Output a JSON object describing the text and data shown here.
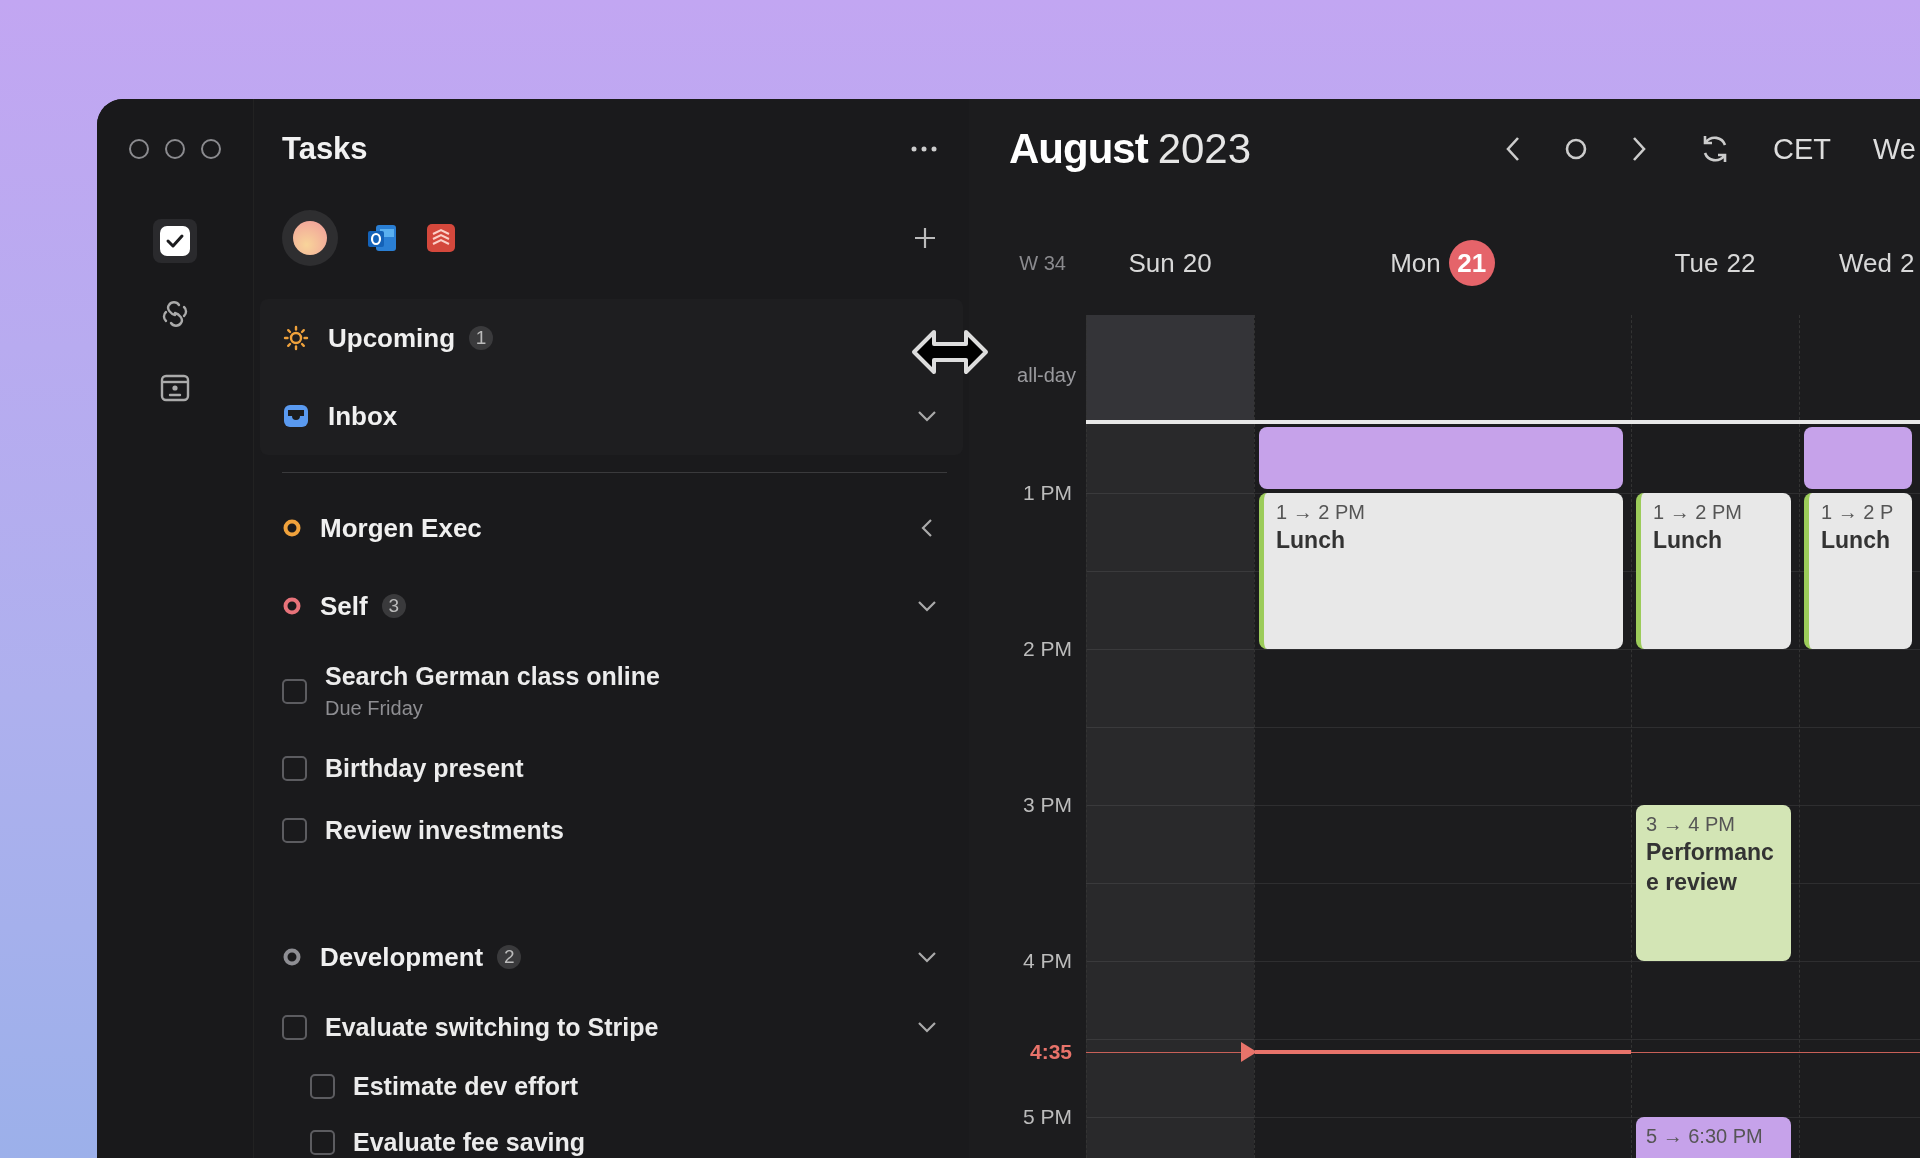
{
  "rail": {
    "items": [
      {
        "kind": "tasks",
        "selected": true
      },
      {
        "kind": "links",
        "selected": false
      },
      {
        "kind": "contacts",
        "selected": false
      }
    ]
  },
  "tasks_panel": {
    "title": "Tasks",
    "smart_lists": [
      {
        "kind": "upcoming",
        "label": "Upcoming",
        "count": "1"
      },
      {
        "kind": "inbox",
        "label": "Inbox",
        "expanded": true
      }
    ],
    "projects": [
      {
        "label": "Morgen Exec",
        "color": "#f0a23c",
        "expanded": false
      },
      {
        "label": "Self",
        "color": "#e8737a",
        "count": "3",
        "expanded": true,
        "tasks": [
          {
            "title": "Search German class online",
            "due": "Due Friday",
            "checked": false
          },
          {
            "title": "Birthday present",
            "checked": false
          },
          {
            "title": "Review investments",
            "checked": false
          }
        ]
      },
      {
        "label": "Development",
        "color": "#8e8e93",
        "count": "2",
        "expanded": true,
        "tasks": [
          {
            "title": "Evaluate switching to Stripe",
            "checked": false,
            "expanded": true,
            "children": [
              {
                "title": "Estimate dev effort",
                "checked": false
              },
              {
                "title": "Evaluate fee saving",
                "checked": false
              }
            ]
          }
        ]
      }
    ]
  },
  "calendar": {
    "month": "August",
    "year": "2023",
    "timezone": "CET",
    "view": "We",
    "week": "W 34",
    "all_day_label": "all-day",
    "hours": [
      "1 PM",
      "2 PM",
      "3 PM",
      "4 PM",
      "5 PM"
    ],
    "now": "4:35",
    "days": [
      {
        "name": "Sun",
        "number": "20",
        "today": false,
        "weekend": true
      },
      {
        "name": "Mon",
        "number": "21",
        "today": true,
        "weekend": false,
        "events": [
          {
            "kind": "plain",
            "color": "#c6a2ea"
          },
          {
            "kind": "stripe",
            "color": "#e8e8e8",
            "time": "1 → 2 PM",
            "title": "Lunch"
          }
        ]
      },
      {
        "name": "Tue",
        "number": "22",
        "today": false,
        "weekend": false,
        "events": [
          {
            "kind": "stripe",
            "color": "#e8e8e8",
            "time": "1 → 2 PM",
            "title": "Lunch"
          },
          {
            "kind": "plain",
            "color": "#d3e5b5",
            "time": "3 → 4 PM",
            "title": "Performance review"
          },
          {
            "kind": "plain",
            "color": "#c6a2ea",
            "time": "5 → 6:30 PM"
          }
        ]
      },
      {
        "name": "Wed",
        "number": "2",
        "today": false,
        "weekend": false,
        "events": [
          {
            "kind": "plain",
            "color": "#c6a2ea"
          },
          {
            "kind": "stripe",
            "color": "#e8e8e8",
            "time": "1 → 2 P",
            "title": "Lunch"
          }
        ]
      }
    ]
  }
}
